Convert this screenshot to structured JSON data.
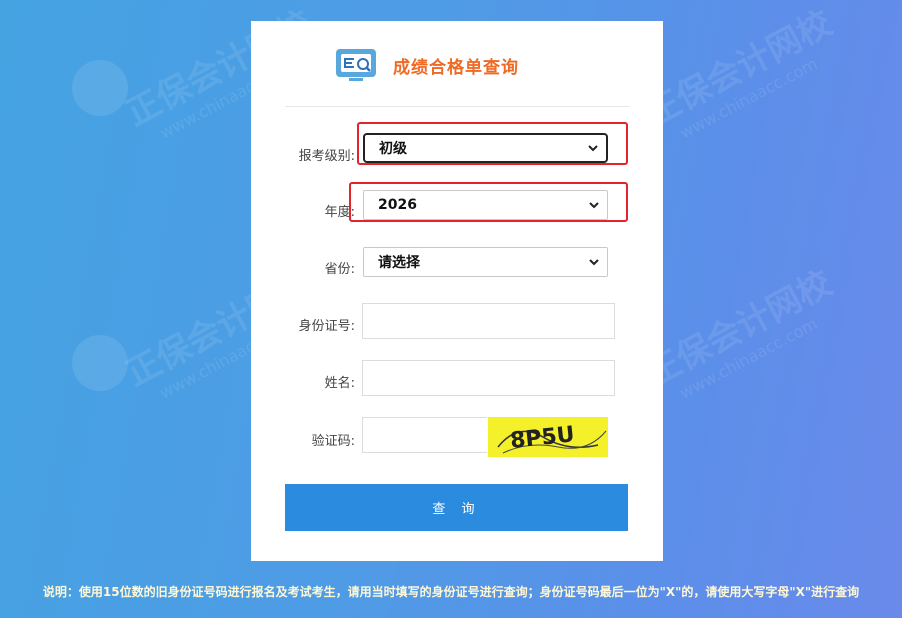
{
  "header": {
    "title": "成绩合格单查询"
  },
  "form": {
    "level": {
      "label": "报考级别:",
      "value": "初级"
    },
    "year": {
      "label": "年度:",
      "value": "2026"
    },
    "province": {
      "label": "省份:",
      "value": "请选择"
    },
    "id_number": {
      "label": "身份证号:",
      "value": ""
    },
    "name": {
      "label": "姓名:",
      "value": ""
    },
    "captcha": {
      "label": "验证码:",
      "value": "",
      "image_text": "8P5U"
    },
    "submit_label": "查 询"
  },
  "note": "说明：使用15位数的旧身份证号码进行报名及考试考生，请用当时填写的身份证号进行查询；身份证号码最后一位为\"X\"的，请使用大写字母\"X\"进行查询",
  "watermark": {
    "text": "正保会计网校",
    "url": "www.chinaacc.com"
  },
  "colors": {
    "accent": "#2b8bdf",
    "title": "#ee6a25",
    "highlight": "#e3242b",
    "captcha_bg": "#f4f12a"
  }
}
